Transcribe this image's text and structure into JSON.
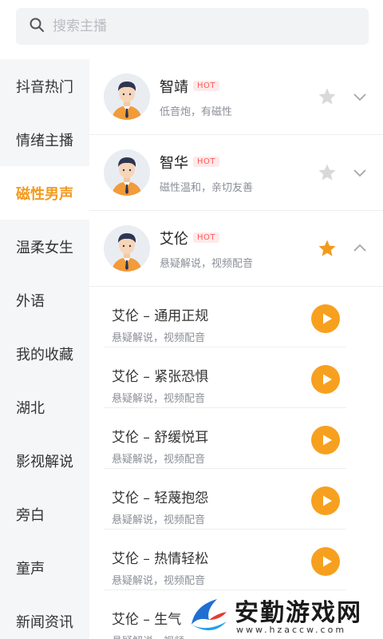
{
  "search": {
    "placeholder": "搜索主播"
  },
  "sidebar": {
    "items": [
      {
        "label": "抖音热门",
        "active": false
      },
      {
        "label": "情绪主播",
        "active": false
      },
      {
        "label": "磁性男声",
        "active": true
      },
      {
        "label": "温柔女生",
        "active": false
      },
      {
        "label": "外语",
        "active": false
      },
      {
        "label": "我的收藏",
        "active": false
      },
      {
        "label": "湖北",
        "active": false
      },
      {
        "label": "影视解说",
        "active": false
      },
      {
        "label": "旁白",
        "active": false
      },
      {
        "label": "童声",
        "active": false
      },
      {
        "label": "新闻资讯",
        "active": false
      }
    ]
  },
  "hosts": [
    {
      "name": "智靖",
      "badge": "HOT",
      "desc": "低音炮，有磁性",
      "favorited": false,
      "expanded": false
    },
    {
      "name": "智华",
      "badge": "HOT",
      "desc": "磁性温和，亲切友善",
      "favorited": false,
      "expanded": false
    },
    {
      "name": "艾伦",
      "badge": "HOT",
      "desc": "悬疑解说，视频配音",
      "favorited": true,
      "expanded": true
    }
  ],
  "tracks": [
    {
      "title": "艾伦 – 通用正规",
      "subtitle": "悬疑解说，视频配音"
    },
    {
      "title": "艾伦 – 紧张恐惧",
      "subtitle": "悬疑解说，视频配音"
    },
    {
      "title": "艾伦 – 舒缓悦耳",
      "subtitle": "悬疑解说，视频配音"
    },
    {
      "title": "艾伦 – 轻蔑抱怨",
      "subtitle": "悬疑解说，视频配音"
    },
    {
      "title": "艾伦 – 热情轻松",
      "subtitle": "悬疑解说，视频配音"
    },
    {
      "title": "艾伦 – 生气",
      "subtitle": "悬疑解说，视频"
    }
  ],
  "watermark": {
    "title": "安勤游戏网",
    "url": "www.hzaccw.com"
  },
  "colors": {
    "accent": "#f39a1e",
    "play": "#f7a01f",
    "hot": "#ff5a5a",
    "sidebar_bg": "#f5f6f8"
  },
  "icons": {
    "search": "search-icon",
    "star": "star-icon",
    "chevron_down": "chevron-down-icon",
    "chevron_up": "chevron-up-icon",
    "play": "play-icon"
  }
}
